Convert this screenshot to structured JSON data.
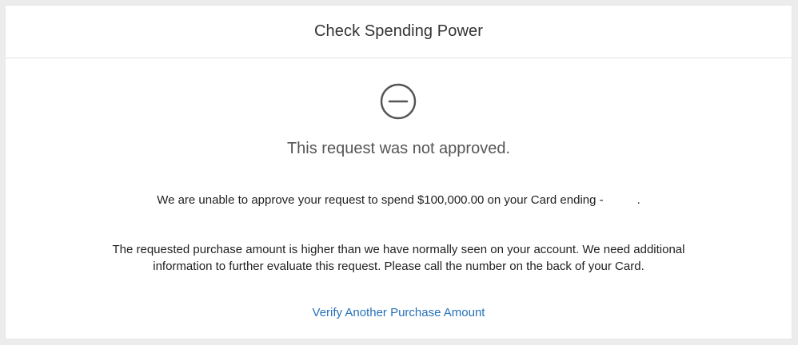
{
  "header": {
    "title": "Check Spending Power"
  },
  "status": {
    "icon": "minus-circle-icon",
    "heading": "This request was not approved."
  },
  "message": {
    "line1_prefix": "We are unable to approve your request to spend $100,000.00 on your Card ending -",
    "line1_suffix": ".",
    "line2": "The requested purchase amount is higher than we have normally seen on your account. We need additional information to further evaluate this request. Please call the number on the back of your Card."
  },
  "actions": {
    "verify_label": "Verify Another Purchase Amount"
  },
  "colors": {
    "link": "#2671b9",
    "icon": "#555555",
    "background": "#ececec",
    "card": "#ffffff"
  }
}
